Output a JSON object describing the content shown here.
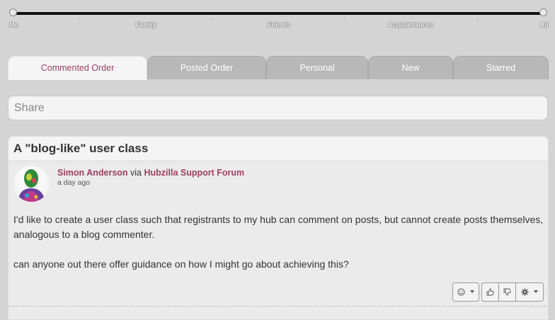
{
  "affinity_slider": {
    "labels": [
      "Me",
      "Family",
      "Friends",
      "Acquaintances",
      "All"
    ]
  },
  "tabs": [
    {
      "label": "Commented Order",
      "active": true
    },
    {
      "label": "Posted Order",
      "active": false
    },
    {
      "label": "Personal",
      "active": false
    },
    {
      "label": "New",
      "active": false
    },
    {
      "label": "Starred",
      "active": false
    }
  ],
  "share": {
    "placeholder": "Share"
  },
  "post": {
    "title": "A \"blog-like\" user class",
    "author": "Simon Anderson",
    "via_text": "via",
    "forum": "Hubzilla Support Forum",
    "timestamp": "a day ago",
    "body": [
      "I'd like to create a user class such that registrants to my hub can comment on posts, but cannot create posts themselves, analogous to a blog commenter.",
      "can anyone out there offer guidance on how I might go about achieving this?"
    ],
    "actions": {
      "emoji_icon": "smiley-icon",
      "like_icon": "thumbs-up-icon",
      "dislike_icon": "thumbs-down-icon",
      "settings_icon": "gear-icon"
    }
  },
  "colors": {
    "accent": "#a04060",
    "background": "#d4d4d4"
  }
}
